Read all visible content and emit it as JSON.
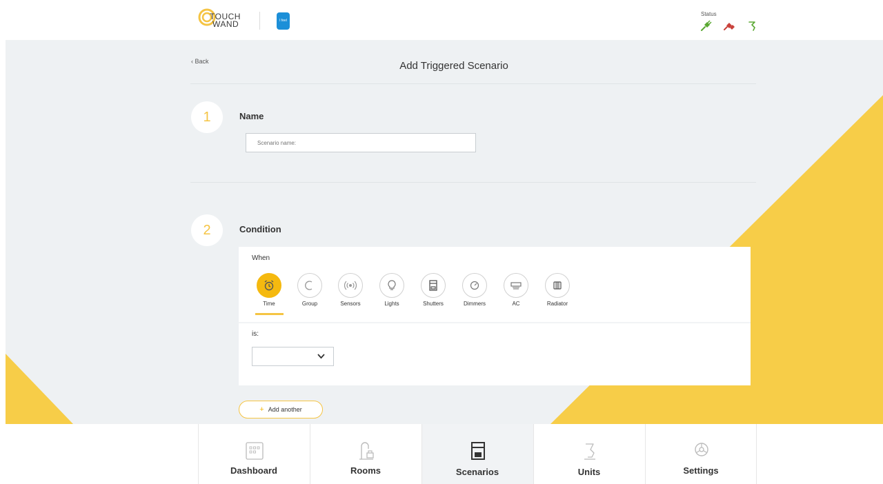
{
  "header": {
    "logo_line1": "TOUCH",
    "logo_line2": "WAND",
    "partner_logo": "I feel",
    "status_label": "Status",
    "status_icons": [
      "status-plug-green-icon",
      "status-plug-red-icon",
      "status-arrow-green-icon"
    ]
  },
  "page": {
    "back_label": "Back",
    "title": "Add Triggered Scenario"
  },
  "steps": [
    {
      "number": "1",
      "label": "Name"
    },
    {
      "number": "2",
      "label": "Condition"
    }
  ],
  "name_input": {
    "placeholder": "Scenario name:",
    "value": ""
  },
  "condition": {
    "when_label": "When",
    "triggers": [
      {
        "label": "Time",
        "icon": "alarm-clock-icon",
        "active": true
      },
      {
        "label": "Group",
        "icon": "group-icon",
        "active": false
      },
      {
        "label": "Sensors",
        "icon": "sensor-icon",
        "active": false
      },
      {
        "label": "Lights",
        "icon": "light-bulb-icon",
        "active": false
      },
      {
        "label": "Shutters",
        "icon": "shutter-icon",
        "active": false
      },
      {
        "label": "Dimmers",
        "icon": "dimmer-icon",
        "active": false
      },
      {
        "label": "AC",
        "icon": "ac-icon",
        "active": false
      },
      {
        "label": "Radiator",
        "icon": "radiator-icon",
        "active": false
      }
    ],
    "is_label": "is:",
    "select_value": ""
  },
  "add_another_label": "Add another",
  "bottom_nav": [
    {
      "label": "Dashboard",
      "icon": "dashboard-icon",
      "active": false
    },
    {
      "label": "Rooms",
      "icon": "rooms-icon",
      "active": false
    },
    {
      "label": "Scenarios",
      "icon": "scenarios-icon",
      "active": true
    },
    {
      "label": "Units",
      "icon": "units-icon",
      "active": false
    },
    {
      "label": "Settings",
      "icon": "settings-icon",
      "active": false
    }
  ],
  "colors": {
    "accent_yellow": "#f5c443",
    "active_yellow": "#f5b90f",
    "background": "#eef1f3",
    "status_green": "#5aa832",
    "status_red": "#c9413b"
  }
}
